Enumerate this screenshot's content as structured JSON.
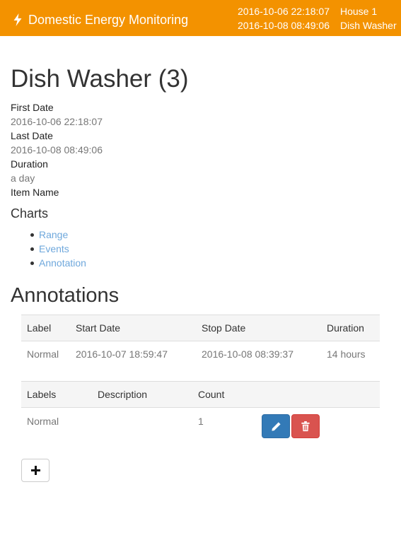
{
  "navbar": {
    "brand": "Domestic Energy Monitoring",
    "range_start": "2016-10-06 22:18:07",
    "range_end": "2016-10-08 08:49:06",
    "house": "House 1",
    "appliance": "Dish Washer",
    "color": "#f39200"
  },
  "page": {
    "title": "Dish Washer (3)",
    "details": [
      {
        "label": "First Date",
        "value": "2016-10-06 22:18:07"
      },
      {
        "label": "Last Date",
        "value": "2016-10-08 08:49:06"
      },
      {
        "label": "Duration",
        "value": "a day"
      },
      {
        "label": "Item Name",
        "value": ""
      }
    ]
  },
  "charts": {
    "heading": "Charts",
    "links": [
      "Range",
      "Events",
      "Annotation"
    ]
  },
  "annotations": {
    "heading": "Annotations",
    "columns": [
      "Label",
      "Start Date",
      "Stop Date",
      "Duration"
    ],
    "rows": [
      {
        "label": "Normal",
        "start": "2016-10-07 18:59:47",
        "stop": "2016-10-08 08:39:37",
        "duration": "14 hours"
      }
    ]
  },
  "labels_table": {
    "columns": [
      "Labels",
      "Description",
      "Count"
    ],
    "rows": [
      {
        "label": "Normal",
        "description": "",
        "count": "1"
      }
    ]
  },
  "icons": {
    "brand": "bolt-icon",
    "edit": "pencil-icon",
    "delete": "trash-icon",
    "add": "plus-icon"
  },
  "colors": {
    "edit_button": "#337ab7",
    "delete_button": "#d9534f",
    "link": "#6fa8dc"
  }
}
